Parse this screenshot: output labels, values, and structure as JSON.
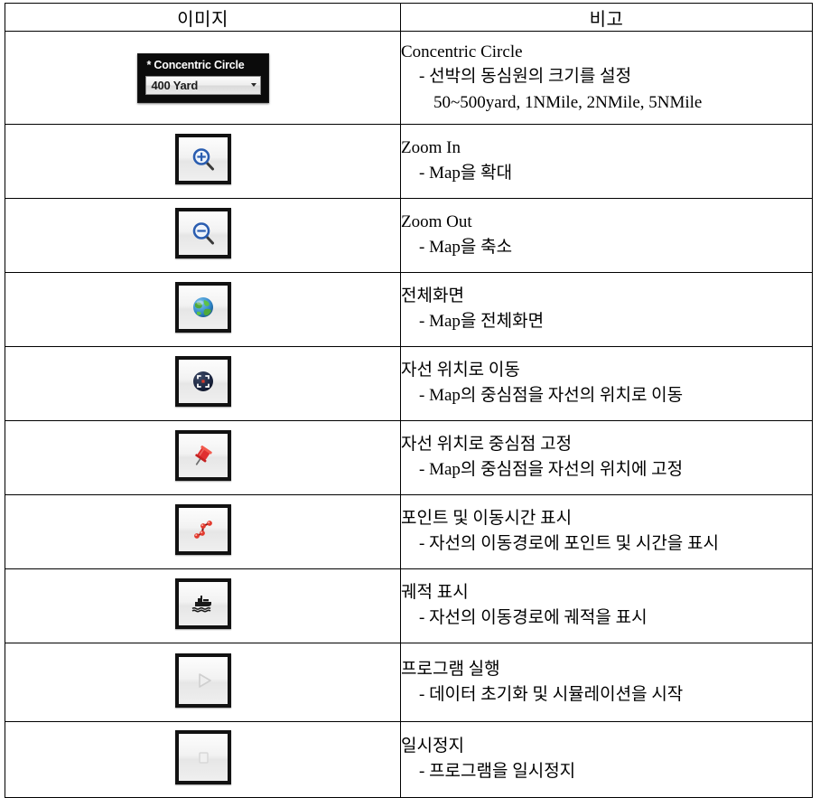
{
  "table": {
    "headers": [
      "이미지",
      "비고"
    ],
    "rows": [
      {
        "icon": "concentric-circle-widget",
        "widget": {
          "label": "* Concentric Circle",
          "selected_value": "400 Yard"
        },
        "title": "Concentric Circle",
        "lines": [
          "- 선박의 동심원의 크기를 설정",
          "50~500yard, 1NMile, 2NMile, 5NMile"
        ]
      },
      {
        "icon": "zoom-in-icon",
        "title": "Zoom In",
        "lines": [
          "- Map을 확대"
        ]
      },
      {
        "icon": "zoom-out-icon",
        "title": "Zoom Out",
        "lines": [
          "- Map을 축소"
        ]
      },
      {
        "icon": "globe-icon",
        "title": "전체화면",
        "lines": [
          "- Map을 전체화면"
        ]
      },
      {
        "icon": "center-on-own-ship-icon",
        "title": "자선 위치로 이동",
        "lines": [
          "- Map의 중심점을 자선의 위치로 이동"
        ]
      },
      {
        "icon": "pin-icon",
        "title": "자선 위치로 중심점 고정",
        "lines": [
          "- Map의 중심점을 자선의 위치에 고정"
        ]
      },
      {
        "icon": "waypoints-icon",
        "title": "포인트 및 이동시간 표시",
        "lines": [
          "- 자선의 이동경로에 포인트 및 시간을 표시"
        ]
      },
      {
        "icon": "ship-track-icon",
        "title": "궤적 표시",
        "lines": [
          "- 자선의 이동경로에 궤적을 표시"
        ]
      },
      {
        "icon": "play-icon",
        "title": "프로그램 실행",
        "lines": [
          "- 데이터 초기화 및 시뮬레이션을 시작"
        ]
      },
      {
        "icon": "stop-icon",
        "title": "일시정지",
        "lines": [
          "- 프로그램을 일시정지"
        ]
      }
    ]
  },
  "colors": {
    "border": "#000000",
    "widget_background": "#0b0b0b",
    "widget_text": "#ffffff",
    "zoom_glyph": "#2a5db0",
    "globe_blue": "#2f86c8",
    "globe_green": "#4ea93b",
    "pin_red": "#e03030",
    "waypoint_red": "#d32020",
    "ship_black": "#1a1a1a",
    "disabled_gray": "#d5d5d5"
  }
}
